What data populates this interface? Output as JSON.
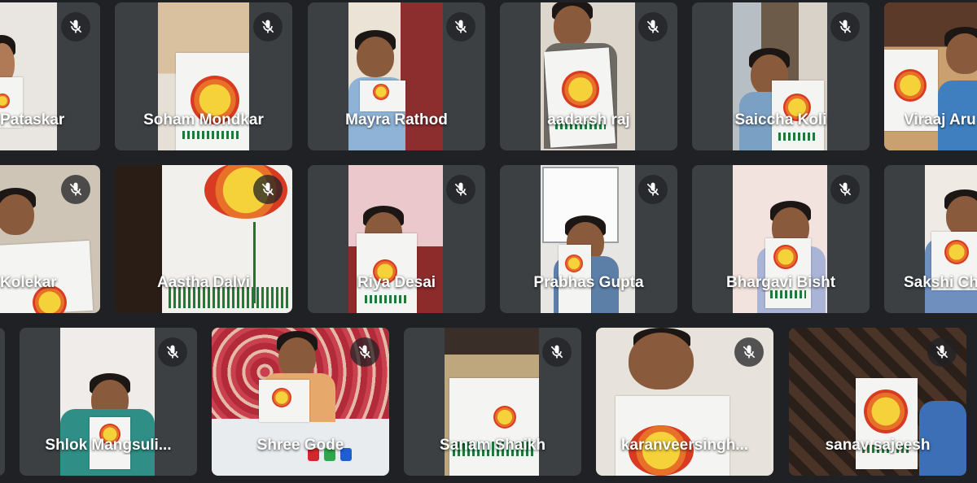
{
  "participants": [
    {
      "name": "Pataskar",
      "muted": true
    },
    {
      "name": "Soham Mondkar",
      "muted": true
    },
    {
      "name": "Mayra Rathod",
      "muted": true
    },
    {
      "name": "aadarsh raj",
      "muted": true
    },
    {
      "name": "Saiccha Koli",
      "muted": true
    },
    {
      "name": "Viraaj Aru",
      "muted": false
    },
    {
      "name": "Kolekar",
      "muted": true
    },
    {
      "name": "Aastha Dalvi",
      "muted": true
    },
    {
      "name": "Riya Desai",
      "muted": true
    },
    {
      "name": "Prabhas Gupta",
      "muted": true
    },
    {
      "name": "Bhargavi Bisht",
      "muted": true
    },
    {
      "name": "Sakshi Ch",
      "muted": false
    },
    {
      "name": "Shlok Mangsuli...",
      "muted": true
    },
    {
      "name": "Shree Gode",
      "muted": true
    },
    {
      "name": "Sanam Shaikh",
      "muted": true
    },
    {
      "name": "karanveersingh...",
      "muted": true
    },
    {
      "name": "sanav sajeesh",
      "muted": true
    }
  ],
  "icons": {
    "mic_off": "mic-off-icon"
  },
  "colors": {
    "background": "#202124",
    "tile": "#3c4043",
    "mic_badge": "#202124",
    "name_text": "#ffffff"
  }
}
